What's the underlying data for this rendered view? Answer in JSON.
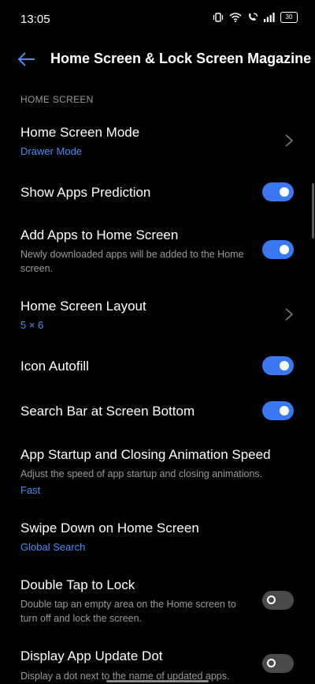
{
  "status": {
    "time": "13:05",
    "battery": "30"
  },
  "header": {
    "title": "Home Screen & Lock Screen Magazine"
  },
  "section": {
    "label": "HOME SCREEN"
  },
  "items": [
    {
      "title": "Home Screen Mode",
      "subtitle": "Drawer Mode"
    },
    {
      "title": "Show Apps Prediction",
      "toggle": true
    },
    {
      "title": "Add Apps to Home Screen",
      "description": "Newly downloaded apps will be added to the Home screen.",
      "toggle": true
    },
    {
      "title": "Home Screen Layout",
      "subtitle": "5 × 6"
    },
    {
      "title": "Icon Autofill",
      "toggle": true
    },
    {
      "title": "Search Bar at Screen Bottom",
      "toggle": true
    },
    {
      "title": "App Startup and Closing Animation Speed",
      "description": "Adjust the speed of app startup and closing animations.",
      "subtitle": "Fast"
    },
    {
      "title": "Swipe Down on Home Screen",
      "subtitle": "Global Search"
    },
    {
      "title": "Double Tap to Lock",
      "description": "Double tap an empty area on the Home screen to turn off and lock the screen.",
      "toggle": false
    },
    {
      "title": "Display App Update Dot",
      "description": "Display a dot next to the name of updated apps.",
      "toggle": false
    }
  ],
  "colors": {
    "accent": "#3a78f2",
    "link": "#4d8bf5",
    "background": "#000000"
  }
}
